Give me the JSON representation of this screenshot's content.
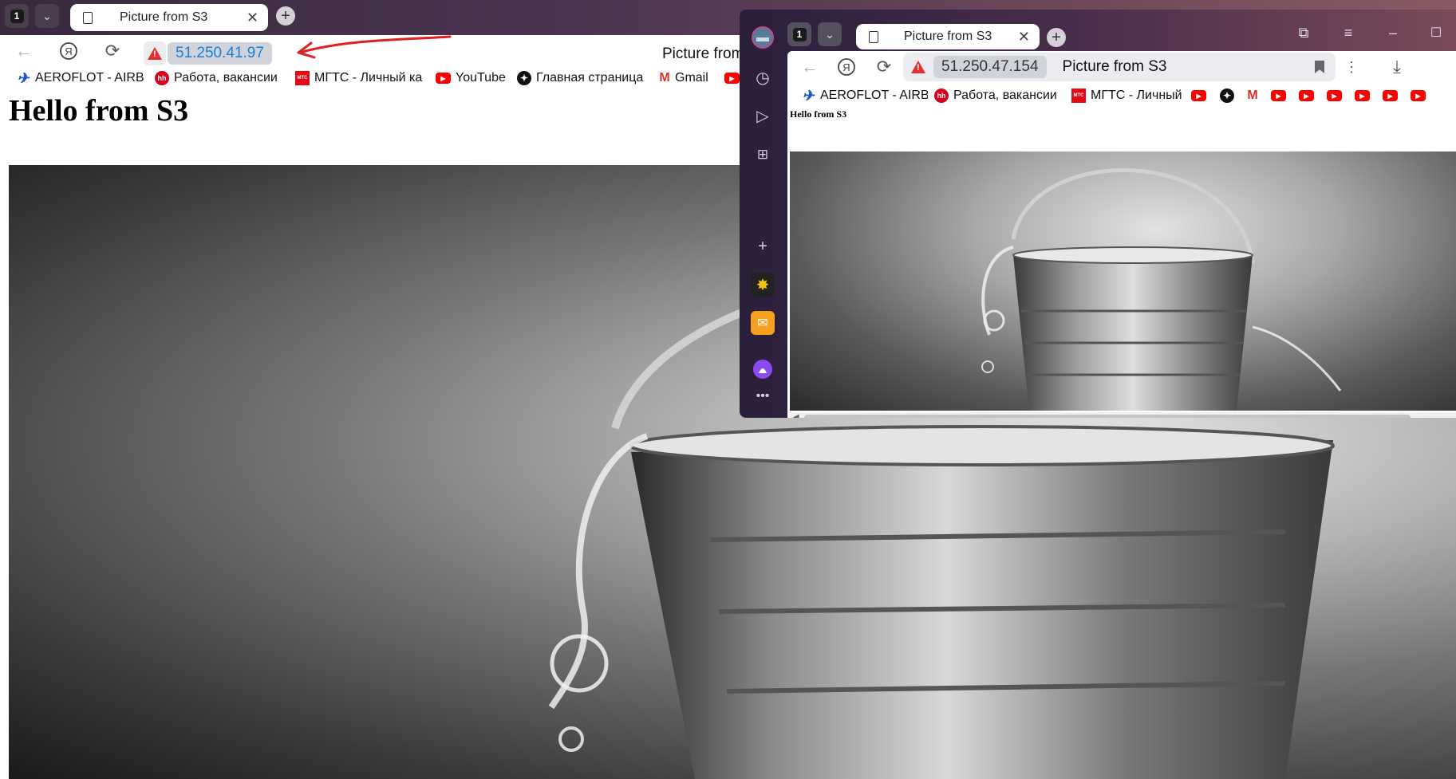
{
  "back": {
    "tab_count": "1",
    "tab_title": "Picture from S3",
    "address": "51.250.41.97",
    "page_title": "Picture from",
    "heading": "Hello from S3",
    "bookmarks": [
      {
        "label": "AEROFLOT - AIRB",
        "icon": "aeroflot-icon"
      },
      {
        "label": "Работа, вакансии",
        "icon": "hh-icon"
      },
      {
        "label": "МГТС - Личный ка",
        "icon": "mgts-icon"
      },
      {
        "label": "YouTube",
        "icon": "youtube-icon"
      },
      {
        "label": "Главная страница",
        "icon": "star-icon"
      },
      {
        "label": "Gmail",
        "icon": "gmail-icon"
      }
    ]
  },
  "front": {
    "tab_count": "1",
    "tab_title": "Picture from S3",
    "address": "51.250.47.154",
    "page_title": "Picture from S3",
    "heading": "Hello from S3",
    "bookmarks": [
      {
        "label": "AEROFLOT - AIRB",
        "icon": "aeroflot-icon"
      },
      {
        "label": "Работа, вакансии",
        "icon": "hh-icon"
      },
      {
        "label": "МГТС - Личный к",
        "icon": "mgts-icon"
      }
    ]
  },
  "colors": {
    "annotation_arrow": "#e02020",
    "warning": "#e03030",
    "url_text": "#1a7fd6"
  }
}
